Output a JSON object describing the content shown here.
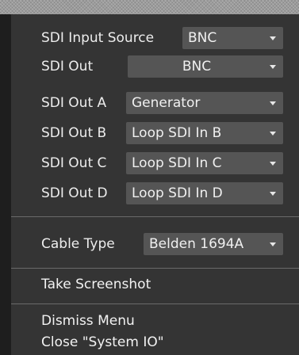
{
  "menu": {
    "rows": [
      {
        "label": "SDI Input Source",
        "value": "BNC"
      },
      {
        "label": "SDI Out",
        "value": "BNC"
      },
      {
        "label": "SDI Out A",
        "value": "Generator"
      },
      {
        "label": "SDI Out B",
        "value": "Loop SDI In B"
      },
      {
        "label": "SDI Out C",
        "value": "Loop SDI In C"
      },
      {
        "label": "SDI Out D",
        "value": "Loop SDI In D"
      }
    ],
    "cable": {
      "label": "Cable Type",
      "value": "Belden 1694A"
    },
    "actions": {
      "take_screenshot": "Take Screenshot",
      "dismiss": "Dismiss Menu",
      "close": "Close \"System IO\""
    }
  }
}
